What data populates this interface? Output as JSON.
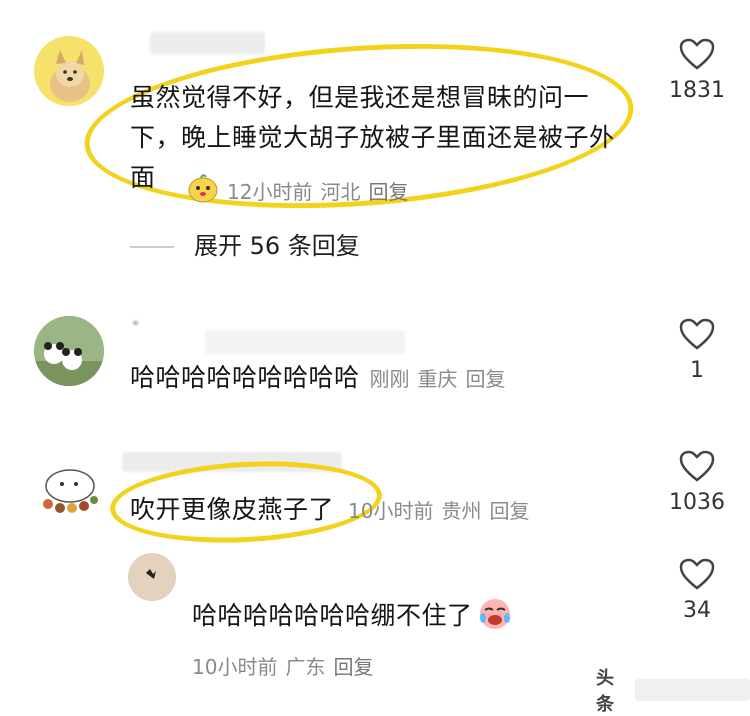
{
  "comments": [
    {
      "text": "虽然觉得不好，但是我还是想冒昧的问一下，晚上睡觉大胡子放被子里面还是被子外面",
      "time": "12小时前",
      "location": "河北",
      "reply": "回复",
      "likes": "1831",
      "expand": "展开 56 条回复"
    },
    {
      "text": "哈哈哈哈哈哈哈哈哈",
      "time": "刚刚",
      "location": "重庆",
      "reply": "回复",
      "likes": "1"
    },
    {
      "text": "吹开更像皮燕子了",
      "time": "10小时前",
      "location": "贵州",
      "reply": "回复",
      "likes": "1036"
    }
  ],
  "sub_reply": {
    "text": "哈哈哈哈哈哈哈绷不住了",
    "time": "10小时前",
    "location": "广东",
    "reply": "回复",
    "likes": "34"
  },
  "watermark": "头条",
  "colors": {
    "highlight": "#f3d21c",
    "meta": "#8a8a8a"
  }
}
